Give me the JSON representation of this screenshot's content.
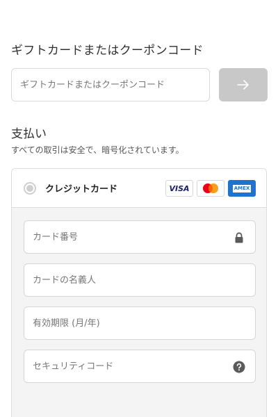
{
  "gift": {
    "title": "ギフトカードまたはクーポンコード",
    "input_placeholder": "ギフトカードまたはクーポンコード",
    "apply_icon": "arrow-right-icon"
  },
  "payment": {
    "heading": "支払い",
    "subtext": "すべての取引は安全で、暗号化されています。",
    "method": {
      "label": "クレジットカード",
      "selected": false,
      "logos": [
        {
          "name": "visa-logo",
          "text": "VISA"
        },
        {
          "name": "mastercard-logo",
          "colors": [
            "#eb001b",
            "#f79e1b"
          ]
        },
        {
          "name": "amex-logo",
          "text": "AMEX"
        }
      ]
    },
    "fields": {
      "card_number_placeholder": "カード番号",
      "card_number_icon": "lock-icon",
      "card_name_placeholder": "カードの名義人",
      "expiry_placeholder": "有効期限 (月/年)",
      "security_code_placeholder": "セキュリティコード",
      "security_code_icon": "help-icon"
    }
  },
  "colors": {
    "apply_button_bg": "#c8c8c8",
    "card_area_bg": "#f4f4f4",
    "border": "#d9d9d9",
    "amex_blue": "#1f72cd",
    "visa_navy": "#1a1f71"
  }
}
